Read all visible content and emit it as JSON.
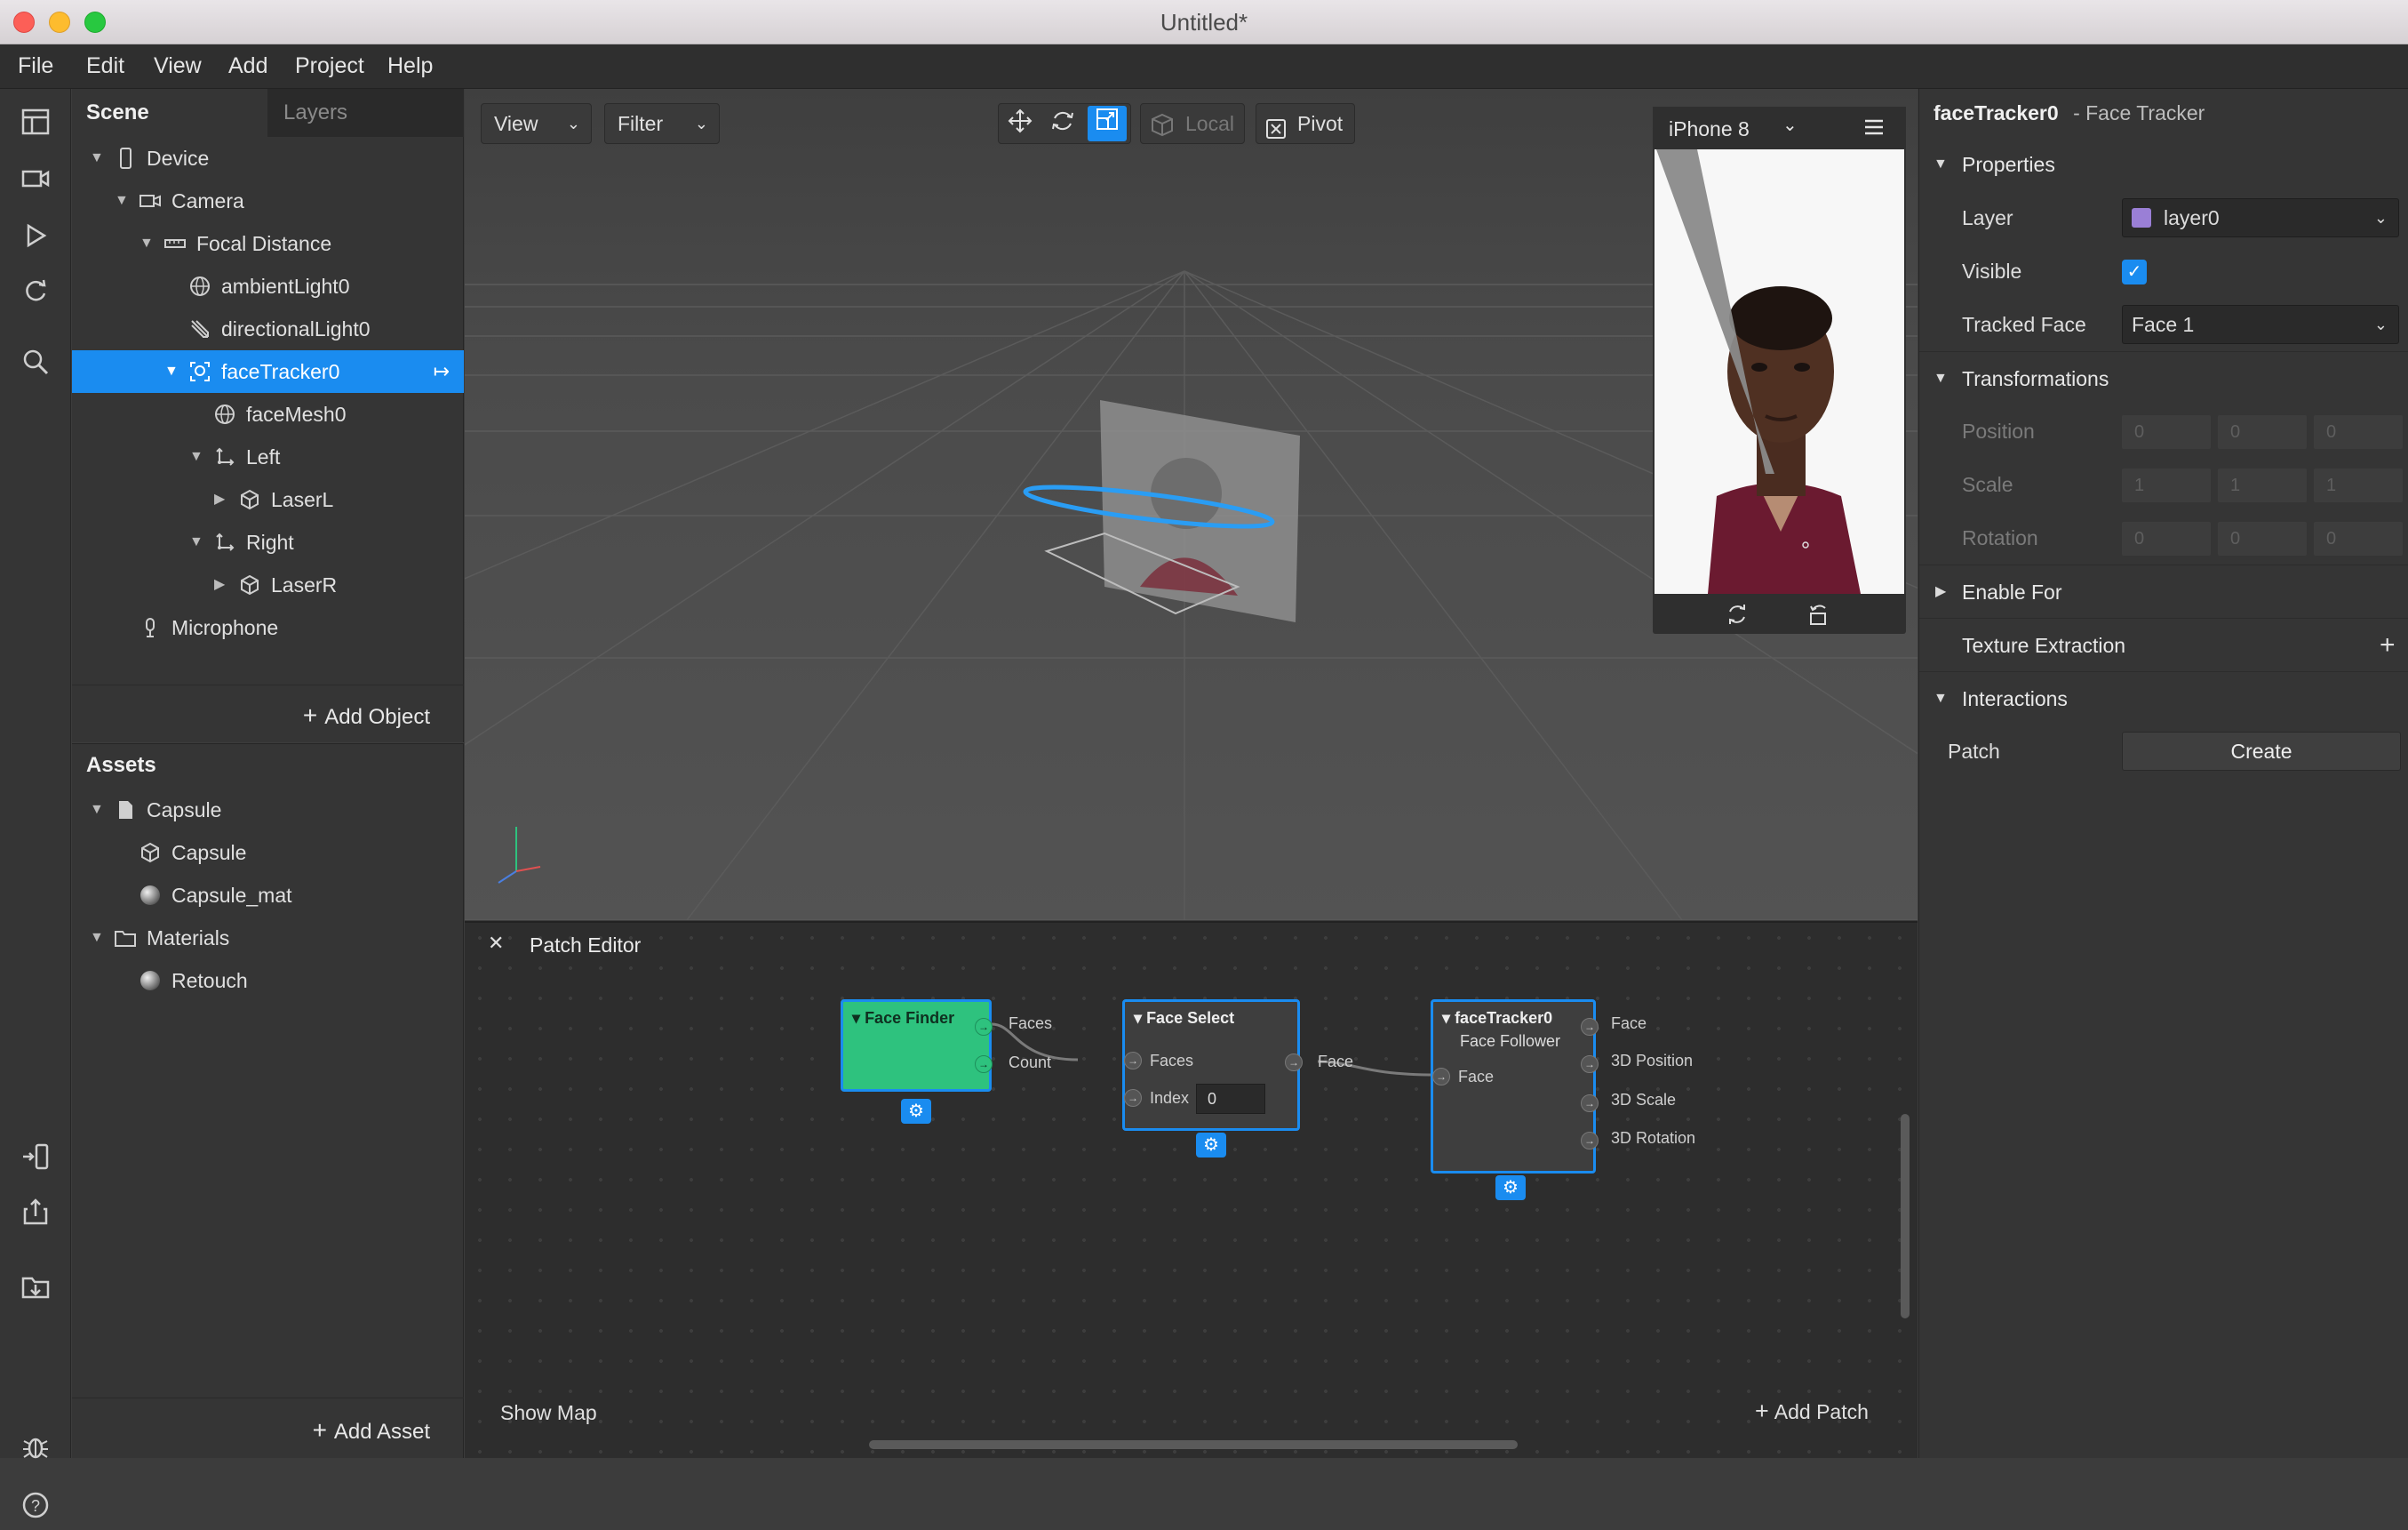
{
  "window": {
    "title": "Untitled*"
  },
  "menu": [
    "File",
    "Edit",
    "View",
    "Add",
    "Project",
    "Help"
  ],
  "scene": {
    "tabs": [
      "Scene",
      "Layers"
    ],
    "tree": [
      {
        "label": "Device",
        "icon": "phone-icon",
        "depth": 0,
        "caret": "down"
      },
      {
        "label": "Camera",
        "icon": "camera-icon",
        "depth": 1,
        "caret": "down"
      },
      {
        "label": "Focal Distance",
        "icon": "ruler-icon",
        "depth": 2,
        "caret": "down"
      },
      {
        "label": "ambientLight0",
        "icon": "globe-icon",
        "depth": 3,
        "caret": ""
      },
      {
        "label": "directionalLight0",
        "icon": "directional-light-icon",
        "depth": 3,
        "caret": ""
      },
      {
        "label": "faceTracker0",
        "icon": "face-tracker-icon",
        "depth": 3,
        "caret": "down",
        "selected": true
      },
      {
        "label": "faceMesh0",
        "icon": "globe-icon",
        "depth": 4,
        "caret": ""
      },
      {
        "label": "Left",
        "icon": "null-object-icon",
        "depth": 4,
        "caret": "down"
      },
      {
        "label": "LaserL",
        "icon": "cube-icon",
        "depth": 5,
        "caret": "right"
      },
      {
        "label": "Right",
        "icon": "null-object-icon",
        "depth": 4,
        "caret": "down"
      },
      {
        "label": "LaserR",
        "icon": "cube-icon",
        "depth": 5,
        "caret": "right"
      },
      {
        "label": "Microphone",
        "icon": "microphone-icon",
        "depth": 1,
        "caret": ""
      }
    ],
    "add_object": "Add Object"
  },
  "assets": {
    "title": "Assets",
    "tree": [
      {
        "label": "Capsule",
        "icon": "file-icon",
        "depth": 0,
        "caret": "down"
      },
      {
        "label": "Capsule",
        "icon": "cube-icon",
        "depth": 1,
        "caret": ""
      },
      {
        "label": "Capsule_mat",
        "icon": "sphere-icon",
        "depth": 1,
        "caret": ""
      },
      {
        "label": "Materials",
        "icon": "folder-icon",
        "depth": 0,
        "caret": "down"
      },
      {
        "label": "Retouch",
        "icon": "sphere-icon",
        "depth": 1,
        "caret": ""
      }
    ],
    "add_asset": "Add Asset"
  },
  "viewport": {
    "view_label": "View",
    "filter_label": "Filter",
    "local_label": "Local",
    "pivot_label": "Pivot",
    "device": "iPhone 8"
  },
  "patch_editor": {
    "title": "Patch Editor",
    "show_map": "Show Map",
    "add_patch": "Add Patch",
    "face_finder": {
      "title": "Face Finder",
      "outputs": [
        "Faces",
        "Count"
      ]
    },
    "face_select": {
      "title": "Face Select",
      "inputs": [
        "Faces",
        "Index"
      ],
      "index_value": "0",
      "outputs": [
        "Face"
      ]
    },
    "face_follower": {
      "title": "faceTracker0",
      "subtitle": "Face Follower",
      "inputs": [
        "Face"
      ],
      "outputs": [
        "Face",
        "3D Position",
        "3D Scale",
        "3D Rotation"
      ]
    }
  },
  "inspector": {
    "object_name": "faceTracker0",
    "object_type": "- Face Tracker",
    "properties_header": "Properties",
    "layer_label": "Layer",
    "layer_value": "layer0",
    "layer_color": "#9a7fd6",
    "visible_label": "Visible",
    "visible": true,
    "tracked_face_label": "Tracked Face",
    "tracked_face_value": "Face 1",
    "transformations_header": "Transformations",
    "position_label": "Position",
    "scale_label": "Scale",
    "rotation_label": "Rotation",
    "position": [
      "0",
      "0",
      "0"
    ],
    "scale": [
      "1",
      "1",
      "1"
    ],
    "rotation": [
      "0",
      "0",
      "0"
    ],
    "enable_for_header": "Enable For",
    "texture_extraction_label": "Texture Extraction",
    "interactions_header": "Interactions",
    "patch_label": "Patch",
    "create_label": "Create"
  },
  "colors": {
    "accent": "#1a8cf0",
    "node_green": "#2ec27e"
  }
}
